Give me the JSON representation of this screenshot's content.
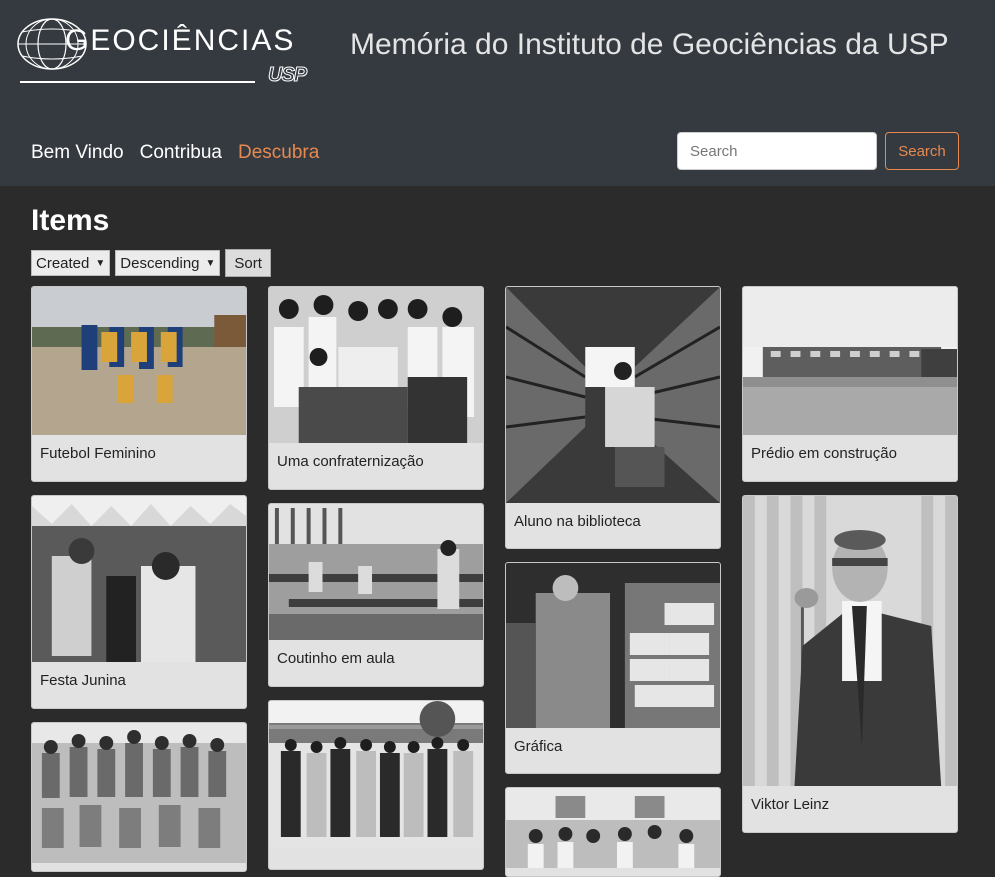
{
  "logo": {
    "text": "GEOCIÊNCIAS",
    "sub": "USP"
  },
  "site_title": "Memória do Instituto de Geociências da USP",
  "nav": [
    {
      "label": "Bem Vindo",
      "active": false
    },
    {
      "label": "Contribua",
      "active": false
    },
    {
      "label": "Descubra",
      "active": true
    }
  ],
  "search": {
    "placeholder": "Search",
    "button_label": "Search"
  },
  "page_title": "Items",
  "sort": {
    "field": "Created",
    "order": "Descending",
    "button_label": "Sort"
  },
  "items": [
    {
      "caption": "Futebol Feminino"
    },
    {
      "caption": "Uma confraternização"
    },
    {
      "caption": "Aluno na biblioteca"
    },
    {
      "caption": "Prédio em construção"
    },
    {
      "caption": "Festa Junina"
    },
    {
      "caption": "Coutinho em aula"
    },
    {
      "caption": "Viktor Leinz"
    },
    {
      "caption": "Gráfica"
    }
  ],
  "colors": {
    "header_bg": "#343a40",
    "page_bg": "#2b2b2b",
    "accent": "#e8894f",
    "card_bg": "#e2e2e2"
  }
}
